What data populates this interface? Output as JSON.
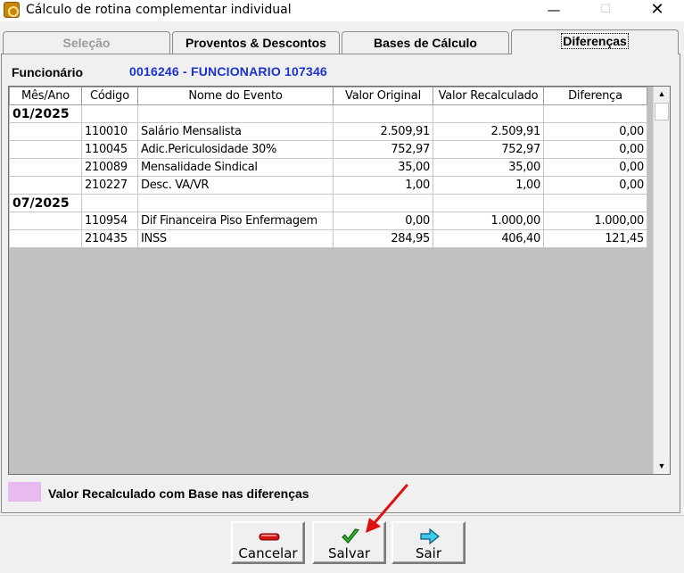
{
  "window": {
    "title": "Cálculo de rotina complementar individual",
    "minimize": "—",
    "maximize": "☐",
    "close": "✕"
  },
  "tabs": [
    {
      "label": "Seleção",
      "state": "disabled"
    },
    {
      "label": "Proventos & Descontos",
      "state": "normal"
    },
    {
      "label": "Bases de Cálculo",
      "state": "normal"
    },
    {
      "label": "Diferenças",
      "state": "selected"
    }
  ],
  "employee": {
    "label": "Funcionário",
    "value": "0016246 - FUNCIONARIO 107346"
  },
  "grid": {
    "columns": [
      "Mês/Ano",
      "Código",
      "Nome do Evento",
      "Valor Original",
      "Valor Recalculado",
      "Diferença"
    ],
    "rows": [
      {
        "type": "group",
        "month": "01/2025"
      },
      {
        "type": "item",
        "code": "110010",
        "name": "Salário Mensalista",
        "original": "2.509,91",
        "recalc": "2.509,91",
        "diff": "0,00"
      },
      {
        "type": "item",
        "code": "110045",
        "name": "Adic.Periculosidade 30%",
        "original": "752,97",
        "recalc": "752,97",
        "diff": "0,00"
      },
      {
        "type": "item",
        "code": "210089",
        "name": "Mensalidade Sindical",
        "original": "35,00",
        "recalc": "35,00",
        "diff": "0,00"
      },
      {
        "type": "item",
        "code": "210227",
        "name": "Desc. VA/VR",
        "original": "1,00",
        "recalc": "1,00",
        "diff": "0,00"
      },
      {
        "type": "group",
        "month": "07/2025"
      },
      {
        "type": "item",
        "code": "110954",
        "name": "Dif Financeira Piso Enfermagem",
        "original": "0,00",
        "recalc": "1.000,00",
        "diff": "1.000,00"
      },
      {
        "type": "item",
        "code": "210435",
        "name": "INSS",
        "original": "284,95",
        "recalc": "406,40",
        "diff": "121,45"
      }
    ]
  },
  "legend": {
    "text": "Valor Recalculado com Base nas diferenças",
    "color": "#e7bbf2"
  },
  "buttons": {
    "cancel": "Cancelar",
    "save": "Salvar",
    "exit": "Sair"
  },
  "colors": {
    "employee_value": "#1a33cc",
    "annotation_arrow": "#e01010"
  }
}
